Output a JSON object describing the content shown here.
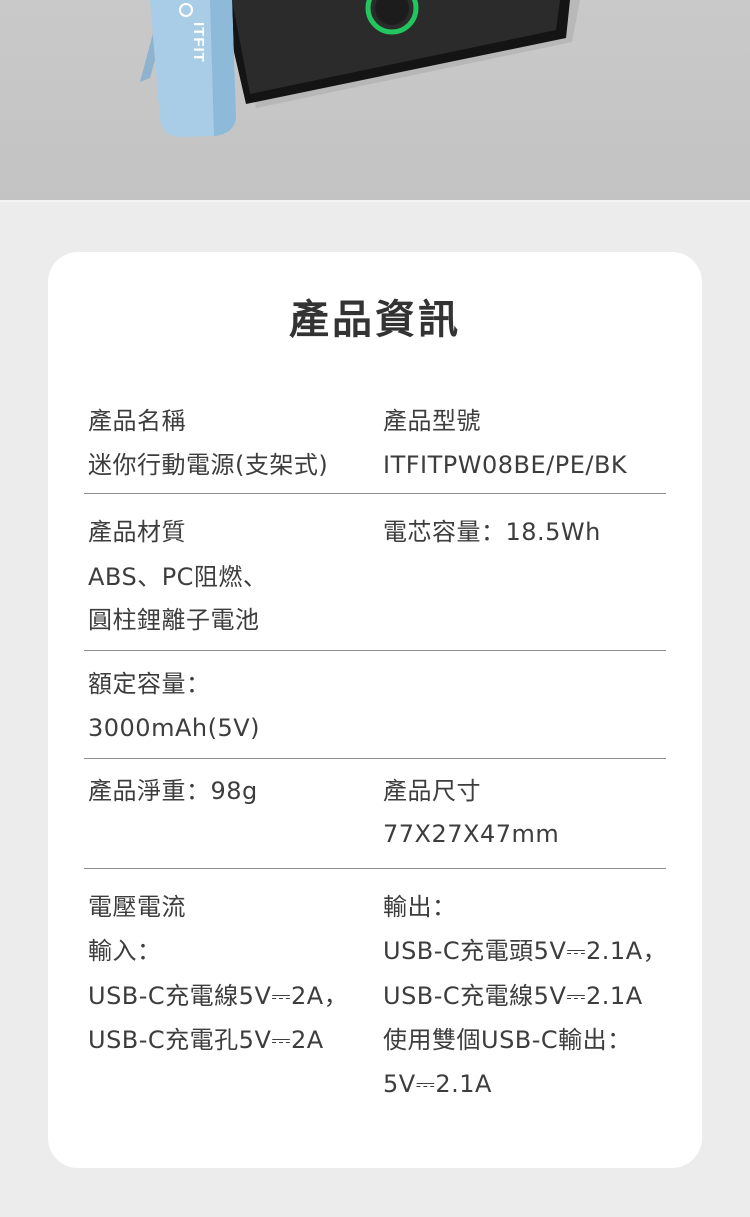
{
  "hero": {
    "brand_on_device": "ITFIT"
  },
  "info": {
    "title": "產品資訊",
    "name_label": "產品名稱",
    "name_value": "迷你行動電源(支架式)",
    "model_label": "產品型號",
    "model_value": "ITFITPW08BE/PE/BK",
    "material_label": "產品材質",
    "material_line1": "ABS、PC阻燃、",
    "material_line2": "圓柱鋰離子電池",
    "cell_capacity": "電芯容量：18.5Wh",
    "rated_label": "額定容量：",
    "rated_value": "3000mAh(5V)",
    "weight": "產品淨重：98g",
    "size_label": "產品尺寸",
    "size_value": "77X27X47mm",
    "voltage_label": "電壓電流",
    "input_label": "輸入：",
    "input_line1": "USB-C充電線5V⎓2A，",
    "input_line2": "USB-C充電孔5V⎓2A",
    "output_label": "輸出：",
    "output_line1": "USB-C充電頭5V⎓2.1A，",
    "output_line2": "USB-C充電線5V⎓2.1A",
    "output_line3": "使用雙個USB-C輸出：",
    "output_line4": "5V⎓2.1A"
  }
}
